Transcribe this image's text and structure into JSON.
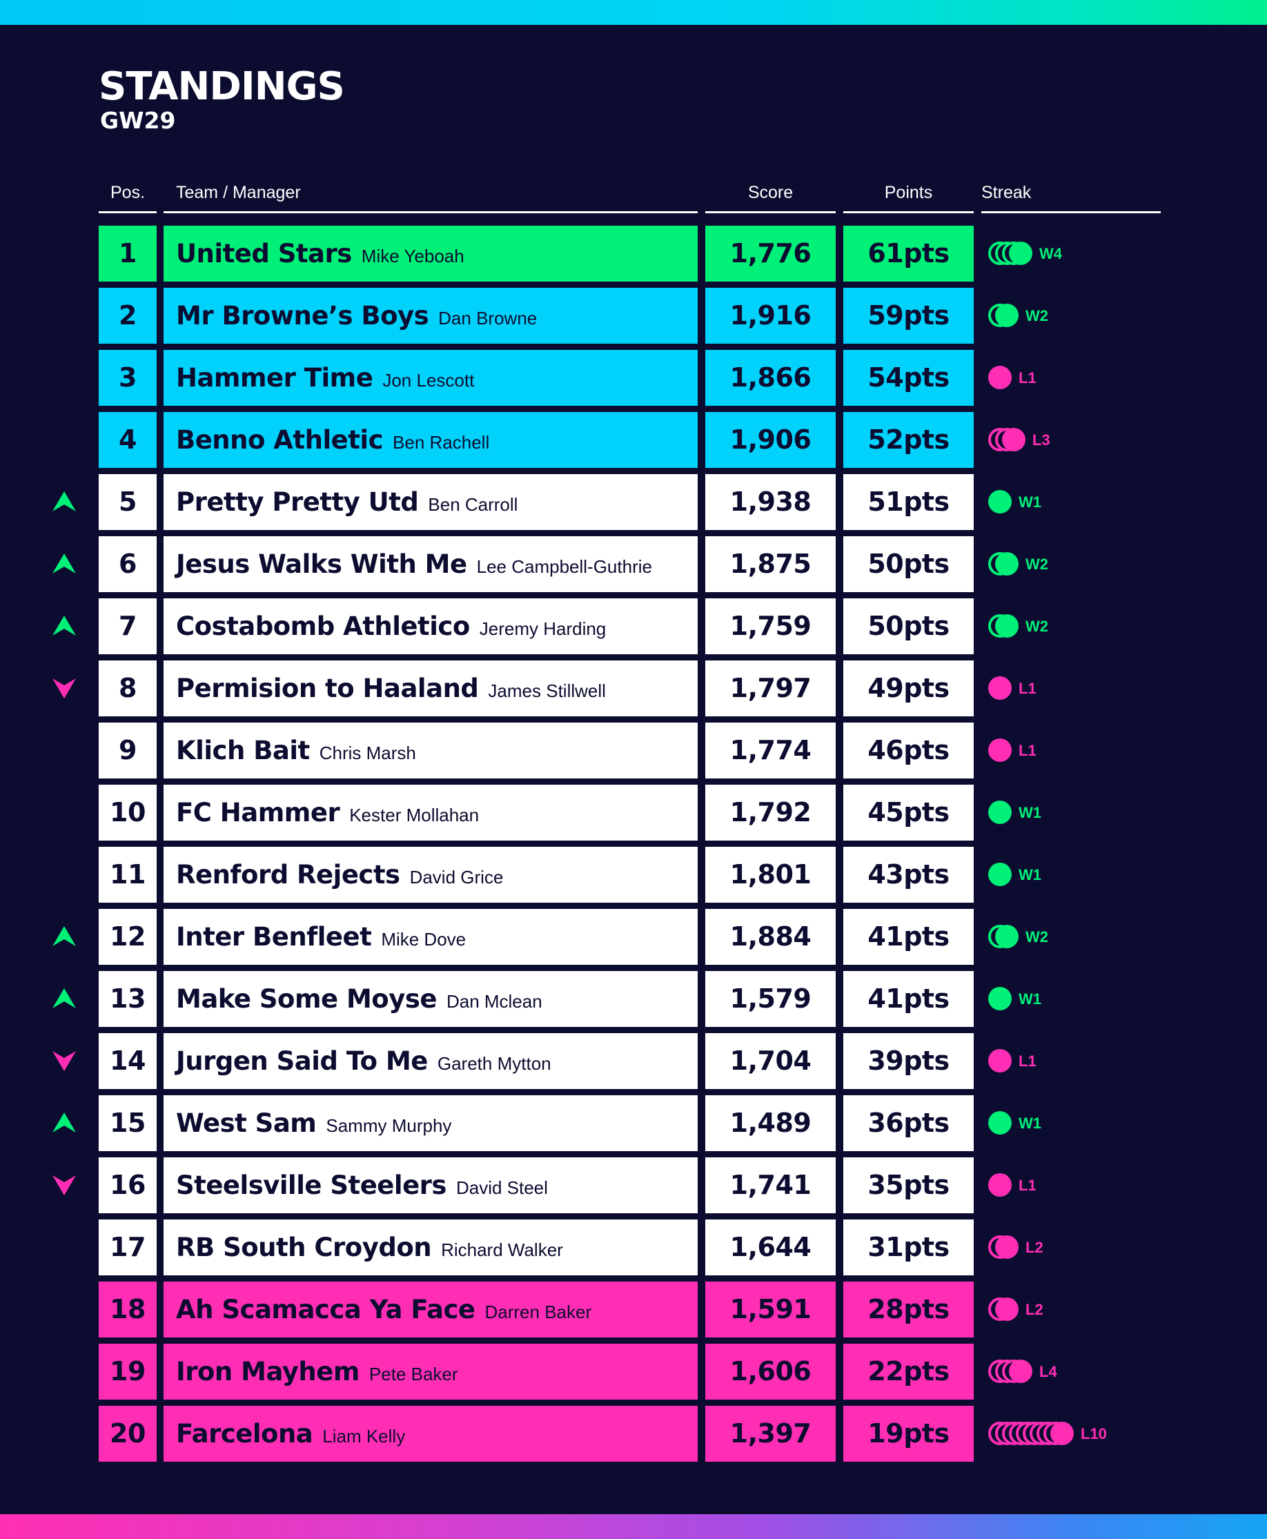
{
  "header": {
    "title": "STANDINGS",
    "subtitle": "GW29"
  },
  "columns": {
    "pos": "Pos.",
    "team": "Team / Manager",
    "score": "Score",
    "points": "Points",
    "streak": "Streak"
  },
  "colors": {
    "background": "#0c0c30",
    "champion": "#00f078",
    "qualification": "#00d2fb",
    "neutral": "#ffffff",
    "relegation": "#ff2eb4",
    "win": "#00f078",
    "loss": "#ff2eb4"
  },
  "rows": [
    {
      "pos": "1",
      "team": "United Stars",
      "manager": "Mike Yeboah",
      "score": "1,776",
      "points": "61pts",
      "streak": "W4",
      "streak_type": "w",
      "streak_len": 4,
      "zone": "green",
      "move": ""
    },
    {
      "pos": "2",
      "team": "Mr Browne’s Boys",
      "manager": "Dan Browne",
      "score": "1,916",
      "points": "59pts",
      "streak": "W2",
      "streak_type": "w",
      "streak_len": 2,
      "zone": "blue",
      "move": ""
    },
    {
      "pos": "3",
      "team": "Hammer Time",
      "manager": "Jon Lescott",
      "score": "1,866",
      "points": "54pts",
      "streak": "L1",
      "streak_type": "l",
      "streak_len": 1,
      "zone": "blue",
      "move": ""
    },
    {
      "pos": "4",
      "team": "Benno Athletic",
      "manager": "Ben Rachell",
      "score": "1,906",
      "points": "52pts",
      "streak": "L3",
      "streak_type": "l",
      "streak_len": 3,
      "zone": "blue",
      "move": ""
    },
    {
      "pos": "5",
      "team": "Pretty Pretty Utd",
      "manager": "Ben Carroll",
      "score": "1,938",
      "points": "51pts",
      "streak": "W1",
      "streak_type": "w",
      "streak_len": 1,
      "zone": "white",
      "move": "up"
    },
    {
      "pos": "6",
      "team": "Jesus Walks With Me",
      "manager": "Lee Campbell-Guthrie",
      "score": "1,875",
      "points": "50pts",
      "streak": "W2",
      "streak_type": "w",
      "streak_len": 2,
      "zone": "white",
      "move": "up"
    },
    {
      "pos": "7",
      "team": "Costabomb Athletico",
      "manager": "Jeremy Harding",
      "score": "1,759",
      "points": "50pts",
      "streak": "W2",
      "streak_type": "w",
      "streak_len": 2,
      "zone": "white",
      "move": "up"
    },
    {
      "pos": "8",
      "team": "Permision to Haaland",
      "manager": "James Stillwell",
      "score": "1,797",
      "points": "49pts",
      "streak": "L1",
      "streak_type": "l",
      "streak_len": 1,
      "zone": "white",
      "move": "down"
    },
    {
      "pos": "9",
      "team": "Klich Bait",
      "manager": "Chris Marsh",
      "score": "1,774",
      "points": "46pts",
      "streak": "L1",
      "streak_type": "l",
      "streak_len": 1,
      "zone": "white",
      "move": ""
    },
    {
      "pos": "10",
      "team": "FC Hammer",
      "manager": "Kester Mollahan",
      "score": "1,792",
      "points": "45pts",
      "streak": "W1",
      "streak_type": "w",
      "streak_len": 1,
      "zone": "white",
      "move": ""
    },
    {
      "pos": "11",
      "team": "Renford Rejects",
      "manager": "David Grice",
      "score": "1,801",
      "points": "43pts",
      "streak": "W1",
      "streak_type": "w",
      "streak_len": 1,
      "zone": "white",
      "move": ""
    },
    {
      "pos": "12",
      "team": "Inter Benfleet",
      "manager": "Mike Dove",
      "score": "1,884",
      "points": "41pts",
      "streak": "W2",
      "streak_type": "w",
      "streak_len": 2,
      "zone": "white",
      "move": "up"
    },
    {
      "pos": "13",
      "team": "Make Some Moyse",
      "manager": "Dan Mclean",
      "score": "1,579",
      "points": "41pts",
      "streak": "W1",
      "streak_type": "w",
      "streak_len": 1,
      "zone": "white",
      "move": "up"
    },
    {
      "pos": "14",
      "team": "Jurgen Said To Me",
      "manager": "Gareth Mytton",
      "score": "1,704",
      "points": "39pts",
      "streak": "L1",
      "streak_type": "l",
      "streak_len": 1,
      "zone": "white",
      "move": "down"
    },
    {
      "pos": "15",
      "team": "West Sam",
      "manager": "Sammy Murphy",
      "score": "1,489",
      "points": "36pts",
      "streak": "W1",
      "streak_type": "w",
      "streak_len": 1,
      "zone": "white",
      "move": "up"
    },
    {
      "pos": "16",
      "team": "Steelsville Steelers",
      "manager": "David Steel",
      "score": "1,741",
      "points": "35pts",
      "streak": "L1",
      "streak_type": "l",
      "streak_len": 1,
      "zone": "white",
      "move": "down"
    },
    {
      "pos": "17",
      "team": "RB South Croydon",
      "manager": "Richard Walker",
      "score": "1,644",
      "points": "31pts",
      "streak": "L2",
      "streak_type": "l",
      "streak_len": 2,
      "zone": "white",
      "move": ""
    },
    {
      "pos": "18",
      "team": "Ah Scamacca Ya Face",
      "manager": "Darren Baker",
      "score": "1,591",
      "points": "28pts",
      "streak": "L2",
      "streak_type": "l",
      "streak_len": 2,
      "zone": "pink",
      "move": ""
    },
    {
      "pos": "19",
      "team": "Iron Mayhem",
      "manager": "Pete Baker",
      "score": "1,606",
      "points": "22pts",
      "streak": "L4",
      "streak_type": "l",
      "streak_len": 4,
      "zone": "pink",
      "move": ""
    },
    {
      "pos": "20",
      "team": "Farcelona",
      "manager": "Liam Kelly",
      "score": "1,397",
      "points": "19pts",
      "streak": "L10",
      "streak_type": "l",
      "streak_len": 10,
      "zone": "pink",
      "move": ""
    }
  ]
}
